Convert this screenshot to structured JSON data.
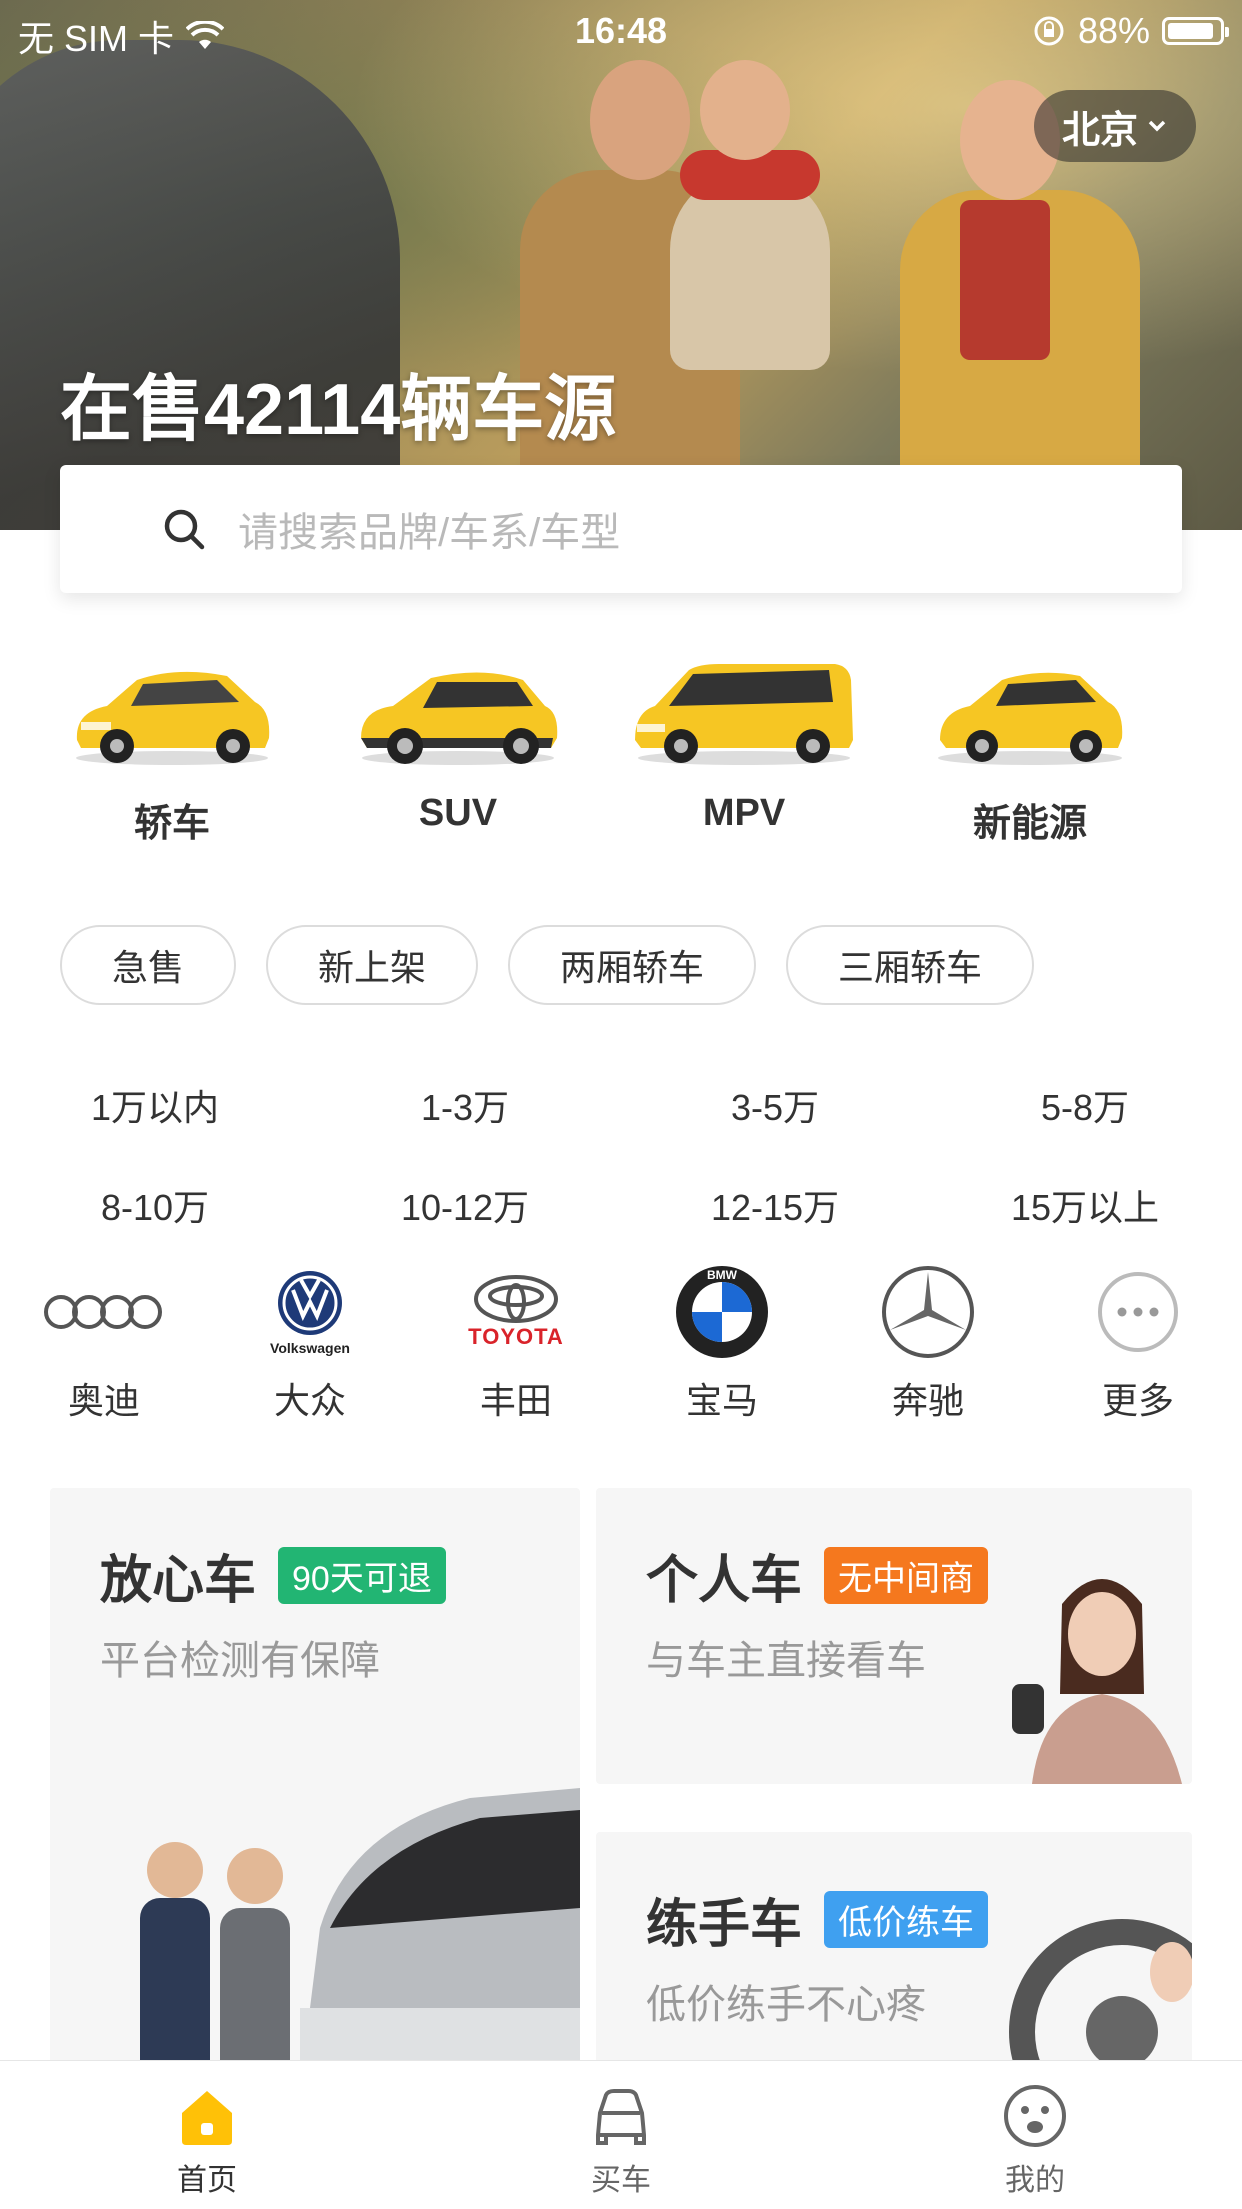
{
  "status_bar": {
    "carrier": "无 SIM 卡",
    "time": "16:48",
    "battery_percent": "88%"
  },
  "hero": {
    "city": "北京",
    "title": "在售42114辆车源"
  },
  "search": {
    "placeholder": "请搜索品牌/车系/车型"
  },
  "categories": [
    {
      "label": "轿车",
      "icon": "sedan-car-icon"
    },
    {
      "label": "SUV",
      "icon": "suv-car-icon"
    },
    {
      "label": "MPV",
      "icon": "mpv-car-icon"
    },
    {
      "label": "新能源",
      "icon": "new-energy-car-icon"
    }
  ],
  "tags": [
    "急售",
    "新上架",
    "两厢轿车",
    "三厢轿车"
  ],
  "price_ranges": [
    [
      "1万以内",
      "1-3万",
      "3-5万",
      "5-8万"
    ],
    [
      "8-10万",
      "10-12万",
      "12-15万",
      "15万以上"
    ]
  ],
  "brands": [
    {
      "label": "奥迪",
      "icon": "audi-logo-icon"
    },
    {
      "label": "大众",
      "icon": "volkswagen-logo-icon",
      "logo_text": "Volkswagen"
    },
    {
      "label": "丰田",
      "icon": "toyota-logo-icon",
      "logo_text": "TOYOTA"
    },
    {
      "label": "宝马",
      "icon": "bmw-logo-icon",
      "logo_text": "BMW"
    },
    {
      "label": "奔驰",
      "icon": "mercedes-logo-icon"
    },
    {
      "label": "更多",
      "icon": "more-dots-icon"
    }
  ],
  "promos": {
    "reliable": {
      "title": "放心车",
      "badge": "90天可退",
      "subtitle": "平台检测有保障",
      "badge_color": "#22b573"
    },
    "personal": {
      "title": "个人车",
      "badge": "无中间商",
      "subtitle": "与车主直接看车",
      "badge_color": "#f5781e"
    },
    "practice": {
      "title": "练手车",
      "badge": "低价练车",
      "subtitle": "低价练手不心疼",
      "badge_color": "#3fa0f0"
    }
  },
  "tabbar": {
    "items": [
      {
        "label": "首页",
        "icon": "home-icon",
        "active": true
      },
      {
        "label": "买车",
        "icon": "car-front-icon",
        "active": false
      },
      {
        "label": "我的",
        "icon": "smiley-face-icon",
        "active": false
      }
    ],
    "active_color": "#ffc107",
    "inactive_color": "#666666"
  },
  "colors": {
    "accent_yellow": "#ffc107",
    "car_yellow": "#f6c623"
  }
}
